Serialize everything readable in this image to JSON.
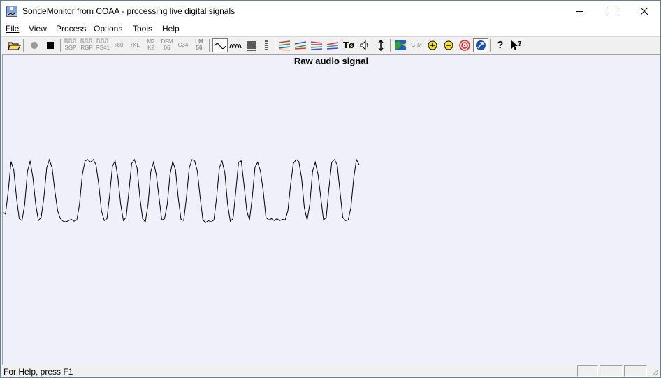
{
  "window": {
    "title": "SondeMonitor from COAA - processing live digital signals"
  },
  "menubar": {
    "items": [
      {
        "label": "File"
      },
      {
        "label": "View"
      },
      {
        "label": "Process"
      },
      {
        "label": "Options"
      },
      {
        "label": "Tools"
      },
      {
        "label": "Help"
      }
    ]
  },
  "toolbar": {
    "sonde_labels": {
      "sgp": [
        "SGP"
      ],
      "rgp": [
        "RGP"
      ],
      "rs41": [
        "RS41"
      ],
      "t80": [
        "80"
      ],
      "kl": [
        "KL"
      ],
      "m2k2": [
        "M2",
        "K2"
      ],
      "dfm06": [
        "DFM",
        "06"
      ],
      "c34": [
        "C34"
      ],
      "lm56": [
        "LM",
        "56"
      ]
    },
    "gm_label": "G-M"
  },
  "plot": {
    "title": "Raw audio signal",
    "colors": {
      "background": "#f0f0fa",
      "trace": "#000000"
    },
    "signal_samples": [
      0.18,
      0.15,
      0.5,
      0.95,
      0.82,
      0.4,
      0.08,
      0.05,
      0.3,
      0.8,
      0.96,
      0.7,
      0.3,
      0.05,
      0.1,
      0.4,
      0.85,
      0.98,
      0.85,
      0.5,
      0.2,
      0.08,
      0.04,
      0.03,
      0.05,
      0.07,
      0.04,
      0.06,
      0.3,
      0.75,
      0.96,
      0.98,
      0.94,
      0.98,
      0.9,
      0.6,
      0.2,
      0.05,
      0.08,
      0.45,
      0.88,
      0.96,
      0.7,
      0.3,
      0.05,
      0.1,
      0.5,
      0.92,
      0.98,
      0.85,
      0.4,
      0.08,
      0.03,
      0.3,
      0.8,
      0.94,
      0.75,
      0.4,
      0.06,
      0.08,
      0.3,
      0.75,
      0.95,
      0.82,
      0.4,
      0.07,
      0.05,
      0.4,
      0.85,
      0.98,
      0.96,
      0.8,
      0.4,
      0.06,
      0.02,
      0.05,
      0.03,
      0.06,
      0.4,
      0.85,
      0.96,
      0.78,
      0.3,
      0.04,
      0.08,
      0.5,
      0.94,
      0.96,
      0.6,
      0.2,
      0.06,
      0.4,
      0.86,
      0.94,
      0.8,
      0.5,
      0.1,
      0.06,
      0.08,
      0.05,
      0.08,
      0.05,
      0.07,
      0.06,
      0.2,
      0.6,
      0.92,
      0.98,
      0.95,
      0.7,
      0.25,
      0.06,
      0.3,
      0.8,
      0.94,
      0.75,
      0.4,
      0.06,
      0.1,
      0.55,
      0.94,
      0.98,
      0.9,
      0.5,
      0.1,
      0.05,
      0.06,
      0.25,
      0.7,
      0.98,
      0.9
    ]
  },
  "statusbar": {
    "text": "For Help, press F1"
  }
}
